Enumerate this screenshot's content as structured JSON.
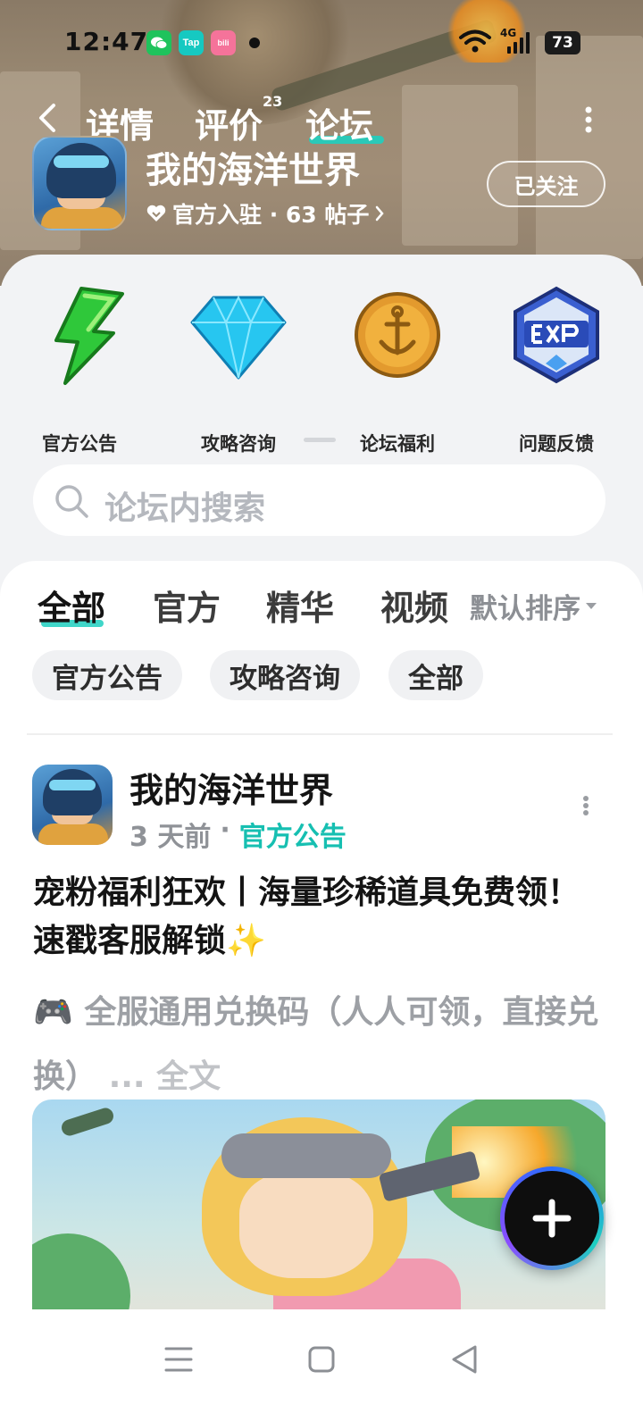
{
  "status_bar": {
    "time": "12:47",
    "apps": [
      "微信",
      "Tap",
      "bilibili"
    ],
    "network": "4G",
    "battery": "73"
  },
  "nav": {
    "tabs": [
      "详情",
      "评价",
      "论坛"
    ],
    "active_tab": "论坛",
    "review_count": "23"
  },
  "game": {
    "title": "我的海洋世界",
    "meta": "官方入驻 · 63 帖子",
    "follow_label": "已关注"
  },
  "shortcuts": [
    {
      "label": "官方公告",
      "icon": "lightning-icon"
    },
    {
      "label": "攻略咨询",
      "icon": "diamond-icon"
    },
    {
      "label": "论坛福利",
      "icon": "anchor-coin-icon"
    },
    {
      "label": "问题反馈",
      "icon": "exp-badge-icon"
    }
  ],
  "search": {
    "placeholder": "论坛内搜索"
  },
  "feed": {
    "tabs": [
      "全部",
      "官方",
      "精华",
      "视频"
    ],
    "active_tab": "全部",
    "sort_label": "默认排序",
    "chips": [
      "官方公告",
      "攻略咨询",
      "全部"
    ]
  },
  "post": {
    "author": "我的海洋世界",
    "time": "3 天前",
    "separator": "·",
    "category": "官方公告",
    "title": "宠粉福利狂欢丨海量珍稀道具免费领！速戳客服解锁✨",
    "excerpt": "🎮 全服通用兑换码（人人可领，直接兑换）",
    "more_label": "... 全文"
  },
  "colors": {
    "accent": "#1ecfc0",
    "category_text": "#16bfb1"
  }
}
